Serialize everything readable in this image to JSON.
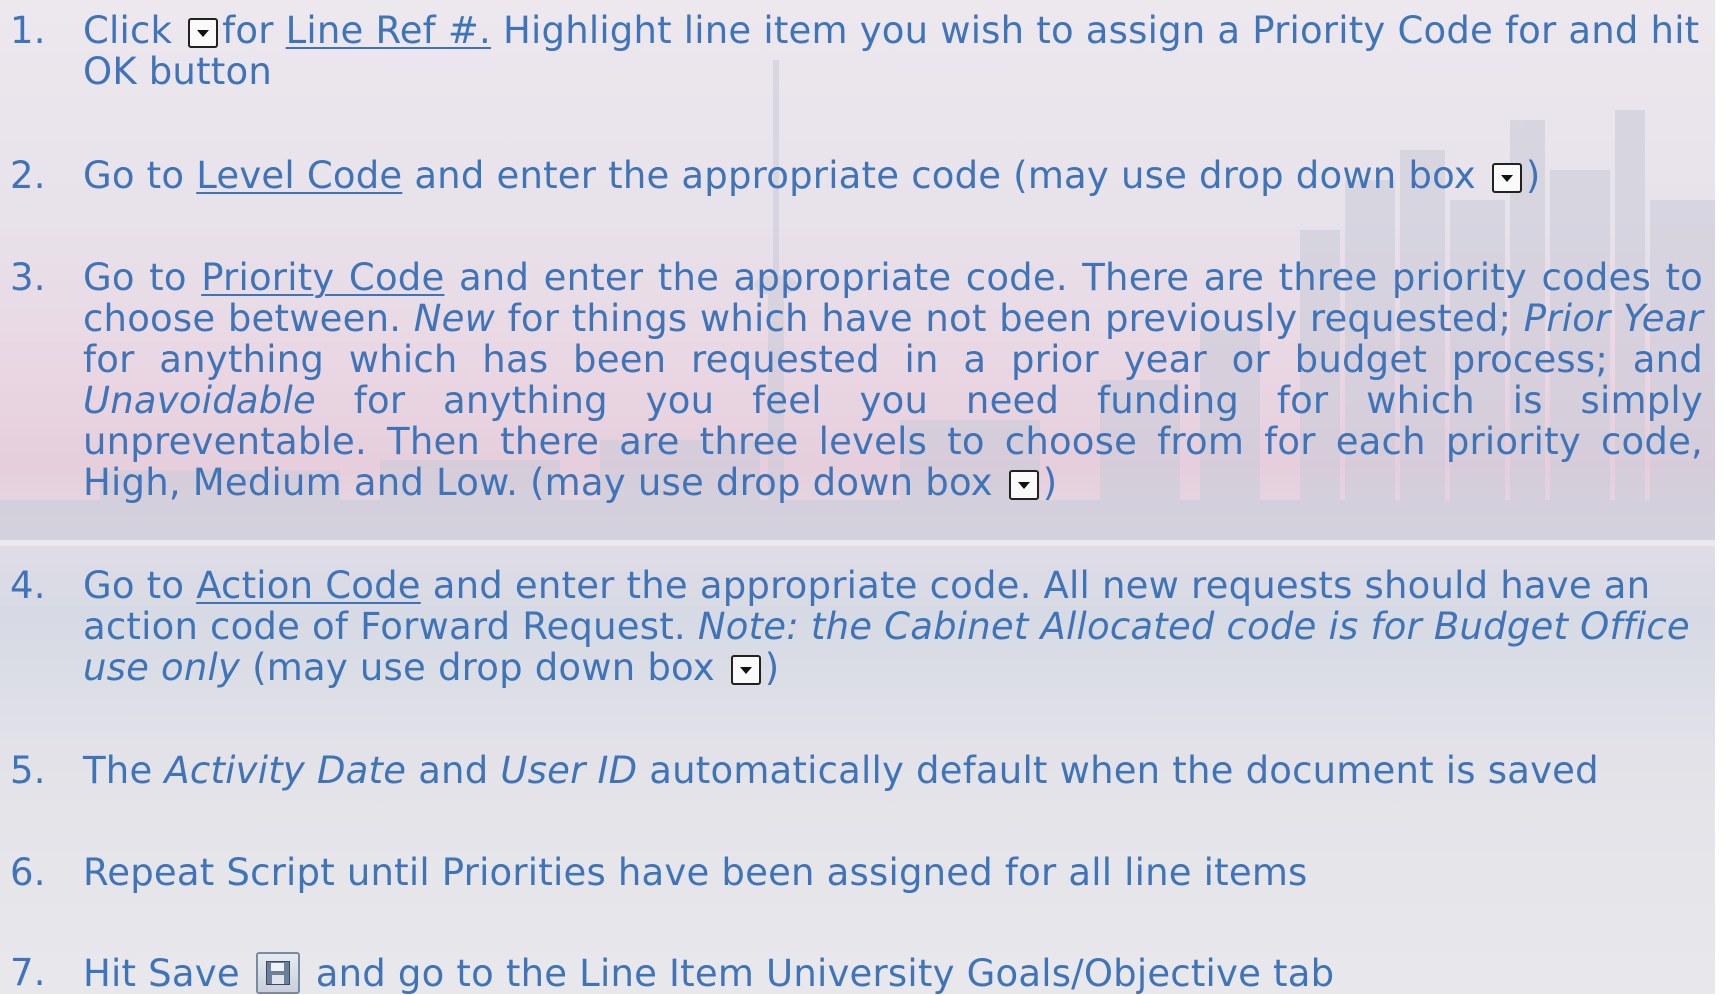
{
  "steps": [
    {
      "num": "1.",
      "parts": {
        "a": "Click",
        "b": "for",
        "c": "Line Ref #.",
        "d": "Highlight line item you wish to assign a Priority Code for and hit OK button"
      }
    },
    {
      "num": "2.",
      "parts": {
        "a": "Go to",
        "b": "Level Code",
        "c": "and enter the appropriate code (may use drop down box",
        "d": ")"
      }
    },
    {
      "num": "3.",
      "parts": {
        "a": "Go to",
        "b": "Priority Code",
        "c": "and enter the appropriate code. There are three priority codes to choose between.",
        "d": "New",
        "e": "for things which have not been previously requested;",
        "f": "Prior Year",
        "g": "for anything which has been requested in a prior year or budget process; and",
        "h": "Unavoidable",
        "i": "for anything you feel you need funding for which is simply unpreventable. Then there are three levels to choose from for each priority code, High, Medium and Low. (may use drop down box",
        "j": ")"
      }
    },
    {
      "num": "4.",
      "parts": {
        "a": "Go to",
        "b": "Action Code",
        "c": "and enter the appropriate code. All new requests should have an action code of Forward Request.",
        "d": "Note: the Cabinet Allocated code is for Budget Office use only",
        "e": "(may use drop down box",
        "f": ")"
      }
    },
    {
      "num": "5.",
      "parts": {
        "a": "The",
        "b": "Activity Date",
        "c": "and",
        "d": "User ID",
        "e": "automatically default when the document is saved"
      }
    },
    {
      "num": "6.",
      "parts": {
        "a": "Repeat Script until Priorities have been assigned for all line items"
      }
    },
    {
      "num": "7.",
      "parts": {
        "a": "Hit Save",
        "b": "and go to the Line Item University Goals/Objective tab"
      }
    }
  ],
  "icons": {
    "dropdown": "dropdown-arrow-icon",
    "save": "floppy-disk-save-icon"
  },
  "colors": {
    "text": "#3f74b8"
  }
}
